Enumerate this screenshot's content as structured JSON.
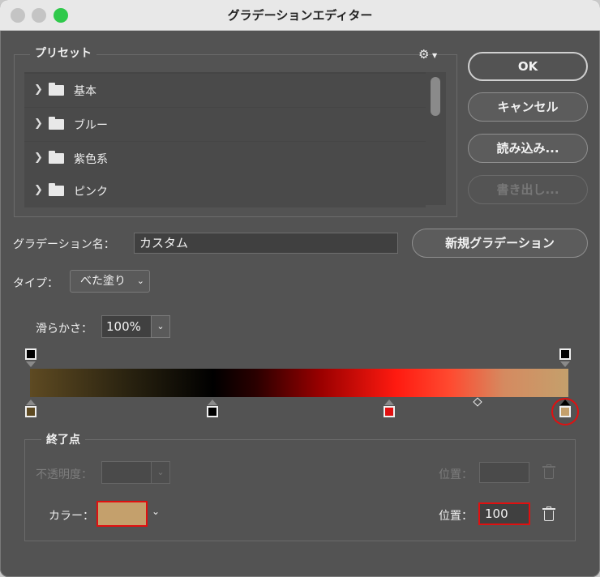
{
  "window": {
    "title": "グラデーションエディター"
  },
  "presets": {
    "legend": "プリセット",
    "gear_icon": "gear-icon",
    "items": [
      {
        "label": "基本"
      },
      {
        "label": "ブルー"
      },
      {
        "label": "紫色系"
      },
      {
        "label": "ピンク"
      }
    ]
  },
  "buttons": {
    "ok": "OK",
    "cancel": "キャンセル",
    "load": "読み込み...",
    "export": "書き出し...",
    "new_gradient": "新規グラデーション"
  },
  "name_field": {
    "label": "グラデーション名：",
    "value": "カスタム"
  },
  "type": {
    "label": "タイプ：",
    "value": "べた塗り"
  },
  "smoothness": {
    "label": "滑らかさ：",
    "value": "100%"
  },
  "gradient": {
    "color_stops": [
      {
        "color": "#5e4a22",
        "position": 0
      },
      {
        "color": "#000000",
        "position": 34
      },
      {
        "color": "#e01010",
        "position": 67
      },
      {
        "color": "#c4a06c",
        "position": 100,
        "selected": true
      }
    ],
    "opacity_stops": [
      {
        "color": "#000000",
        "position": 0
      },
      {
        "color": "#000000",
        "position": 100
      }
    ],
    "midpoint": 83
  },
  "end_point": {
    "legend": "終了点",
    "opacity_label": "不透明度：",
    "opacity_position_label": "位置：",
    "color_label": "カラー：",
    "color_value": "#c4a06c",
    "color_position_label": "位置：",
    "color_position_value": "100"
  },
  "colors": {
    "highlight": "#e01010",
    "accent_green": "#2fc94b"
  }
}
